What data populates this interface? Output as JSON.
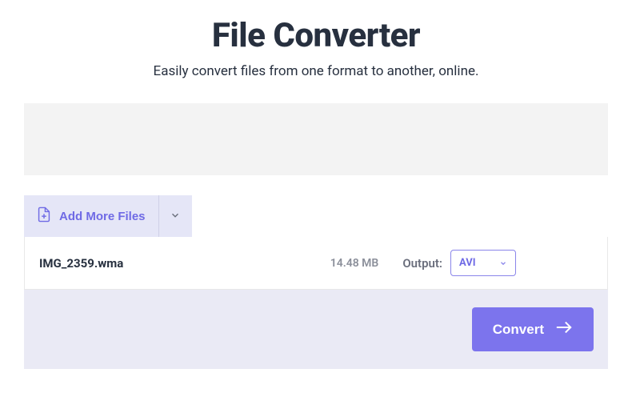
{
  "header": {
    "title": "File Converter",
    "subtitle": "Easily convert files from one format to another, online."
  },
  "toolbar": {
    "add_files_label": "Add More Files"
  },
  "files": [
    {
      "name": "IMG_2359.wma",
      "size": "14.48 MB",
      "output_label": "Output:",
      "output_format": "AVI"
    }
  ],
  "actions": {
    "convert_label": "Convert"
  }
}
